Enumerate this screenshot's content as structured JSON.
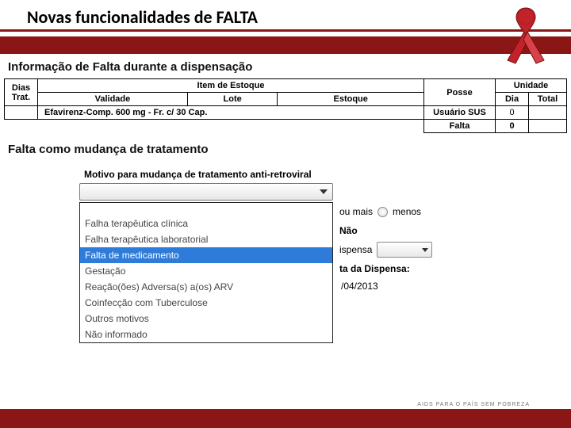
{
  "header": {
    "title": "Novas funcionalidades de FALTA"
  },
  "section1": {
    "heading": "Informação de Falta durante a dispensação"
  },
  "stock_table": {
    "headers": {
      "dias_trat": "Dias Trat.",
      "item_estoque": "Item de Estoque",
      "validade": "Validade",
      "lote": "Lote",
      "estoque": "Estoque",
      "posse": "Posse",
      "unidade": "Unidade",
      "dia": "Dia",
      "total": "Total"
    },
    "row": {
      "item": "Efavirenz-Comp. 600 mg - Fr. c/ 30 Cap.",
      "posse": "Usuário SUS",
      "dia": "0"
    },
    "falta_row": {
      "label": "Falta",
      "value": "0"
    }
  },
  "section2": {
    "heading": "Falta como mudança de tratamento"
  },
  "form": {
    "motivo_label": "Motivo para mudança de tratamento anti-retroviral",
    "options": [
      "",
      "Falha terapêutica clínica",
      "Falha terapêutica laboratorial",
      "Falta de medicamento",
      "Gestação",
      "Reação(ões) Adversa(s) a(os) ARV",
      "Coinfecção com Tuberculose",
      "Outros motivos",
      "Não informado"
    ],
    "selected_index": 3,
    "right": {
      "ou_mais": "ou mais",
      "menos": "menos",
      "nao": "Não",
      "ispensa": "ispensa",
      "data_label": "ta da Dispensa:",
      "data_value": "/04/2013"
    }
  },
  "footer": {
    "slogan": "AIDS PARA O PAÍS SEM POBREZA"
  }
}
